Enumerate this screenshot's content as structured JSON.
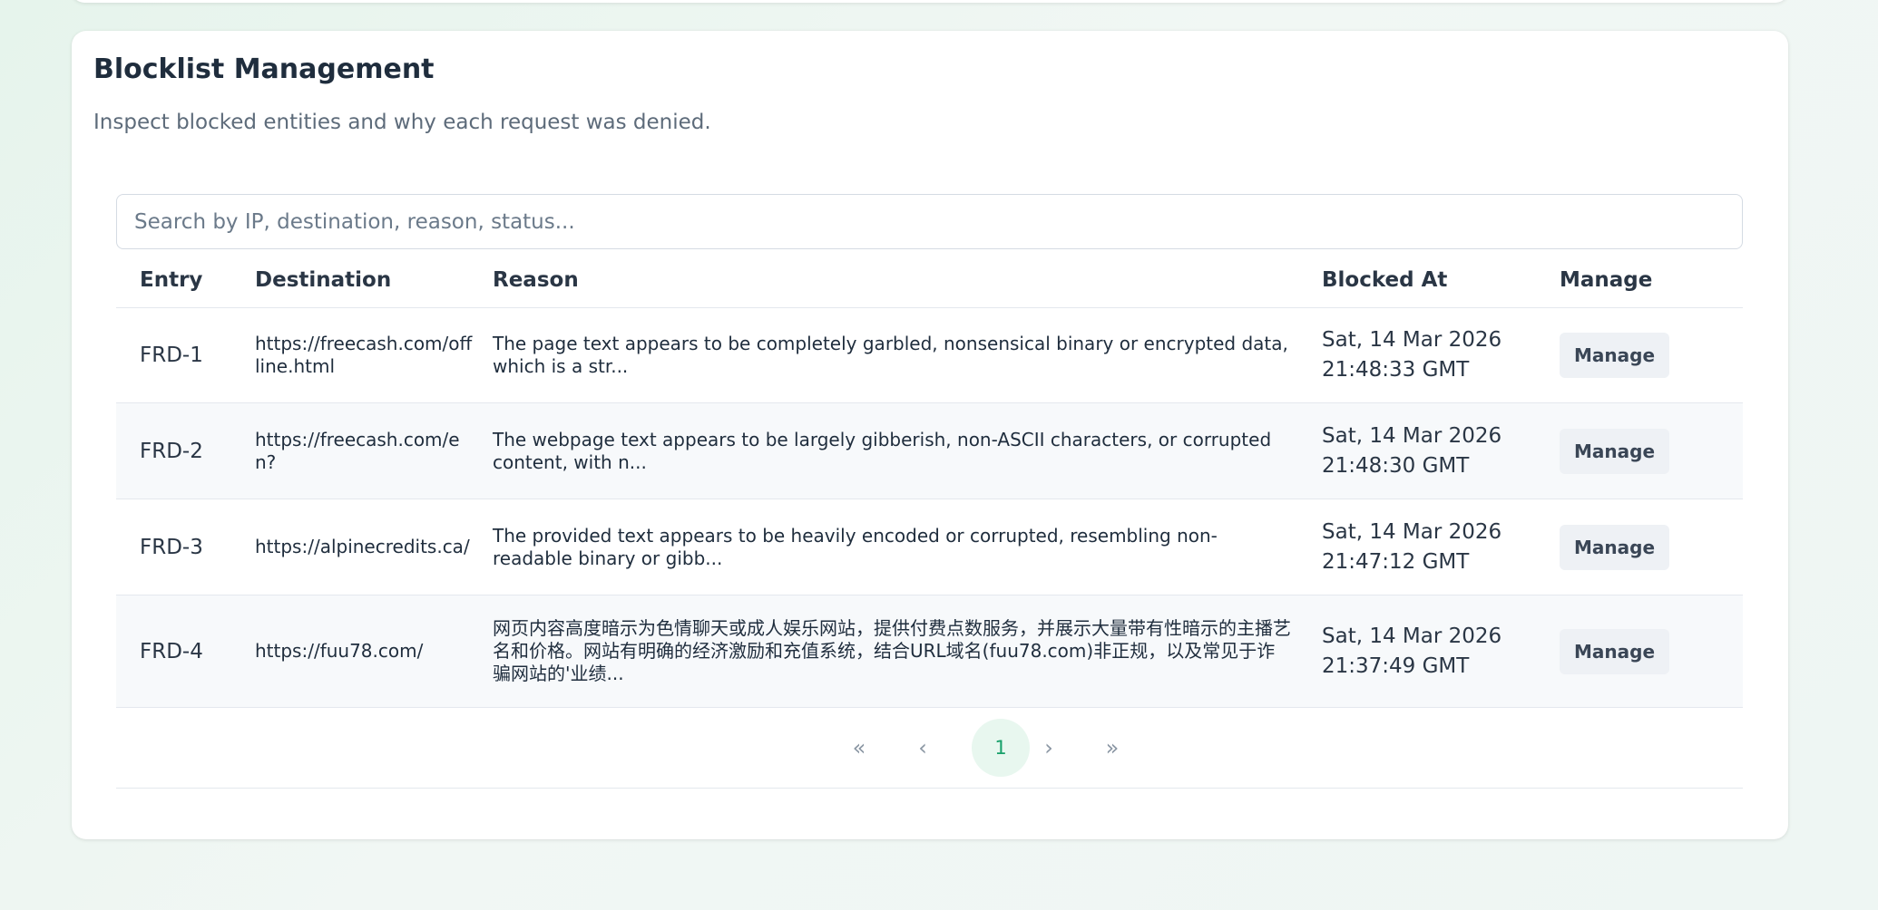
{
  "card": {
    "title": "Blocklist Management",
    "subtitle": "Inspect blocked entities and why each request was denied."
  },
  "search": {
    "placeholder": "Search by IP, destination, reason, status..."
  },
  "table": {
    "columns": [
      "Entry",
      "Destination",
      "Reason",
      "Blocked At",
      "Manage"
    ],
    "rows": [
      {
        "entry": "FRD-1",
        "destination": "https://freecash.com/offline.html",
        "reason": "The page text appears to be completely garbled, nonsensical binary or encrypted data, which is a str...",
        "blocked_at": "Sat, 14 Mar 2026 21:48:33 GMT",
        "manage": "Manage"
      },
      {
        "entry": "FRD-2",
        "destination": "https://freecash.com/en?",
        "reason": "The webpage text appears to be largely gibberish, non-ASCII characters, or corrupted content, with n...",
        "blocked_at": "Sat, 14 Mar 2026 21:48:30 GMT",
        "manage": "Manage"
      },
      {
        "entry": "FRD-3",
        "destination": "https://alpinecredits.ca/",
        "reason": "The provided text appears to be heavily encoded or corrupted, resembling non-readable binary or gibb...",
        "blocked_at": "Sat, 14 Mar 2026 21:47:12 GMT",
        "manage": "Manage"
      },
      {
        "entry": "FRD-4",
        "destination": "https://fuu78.com/",
        "reason": "网页内容高度暗示为色情聊天或成人娱乐网站，提供付费点数服务，并展示大量带有性暗示的主播艺名和价格。网站有明确的经济激励和充值系统，结合URL域名(fuu78.com)非正规，以及常见于诈骗网站的'业绩...",
        "blocked_at": "Sat, 14 Mar 2026 21:37:49 GMT",
        "manage": "Manage"
      }
    ]
  },
  "pagination": {
    "first": "«",
    "prev": "‹",
    "current": "1",
    "next": "›",
    "last": "»"
  }
}
